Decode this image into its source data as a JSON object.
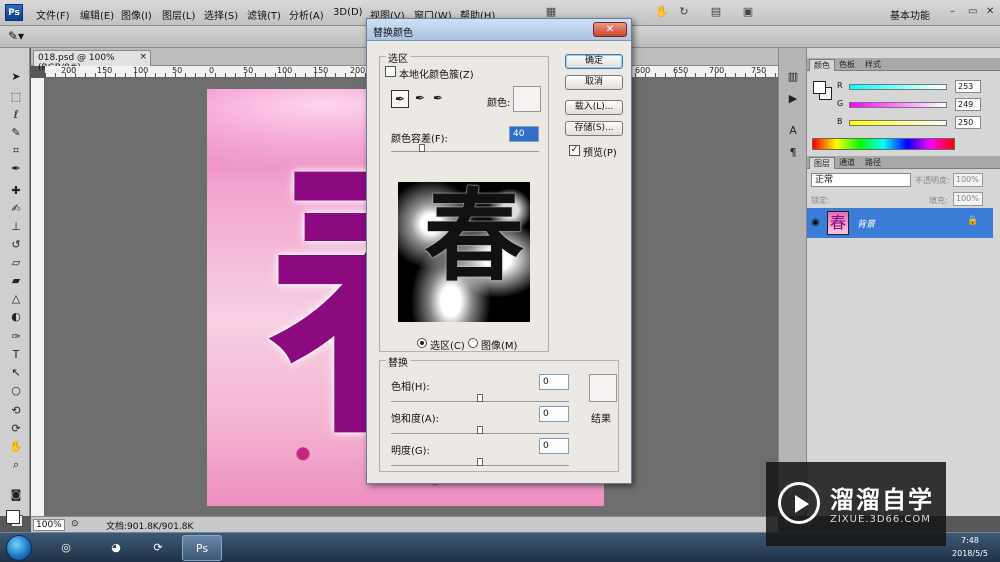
{
  "menubar": {
    "logo": "Ps",
    "items": [
      "文件(F)",
      "编辑(E)",
      "图像(I)",
      "图层(L)",
      "选择(S)",
      "滤镜(T)",
      "分析(A)",
      "3D(D)",
      "视图(V)",
      "窗口(W)",
      "帮助(H)"
    ],
    "workspace": "基本功能",
    "window_buttons": [
      "–",
      "▭",
      "✕"
    ]
  },
  "document": {
    "tab_title": "018.psd @ 100%(RGB/8#)",
    "tab_close": "×",
    "ruler_ticks": [
      "200",
      "150",
      "100",
      "50",
      "0",
      "50",
      "100",
      "150",
      "200",
      "250",
      "300",
      "350",
      "400",
      "450",
      "500",
      "550",
      "600",
      "650",
      "700",
      "750"
    ],
    "artwork_char": "春",
    "zoom": "100%",
    "status": "文档:901.8K/901.8K"
  },
  "dialog": {
    "title": "替换颜色",
    "close": "✕",
    "selection_group": "选区",
    "localized_clusters_label": "本地化颜色簇(Z)",
    "localized_clusters_checked": false,
    "color_label": "颜色:",
    "fuzziness_label": "颜色容差(F):",
    "fuzziness_value": "40",
    "fuzziness_fraction": 0.2,
    "preview_char": "春",
    "radio_selection": "选区(C)",
    "radio_image": "图像(M)",
    "replace_group": "替换",
    "hue_label": "色相(H):",
    "hue_value": "0",
    "saturation_label": "饱和度(A):",
    "saturation_value": "0",
    "lightness_label": "明度(G):",
    "lightness_value": "0",
    "result_label": "结果",
    "ok_label": "确定",
    "cancel_label": "取消",
    "load_label": "载入(L)...",
    "save_label": "存储(S)...",
    "preview_label": "预览(P)",
    "preview_checked": true,
    "sample_color": "#f6f2f2"
  },
  "color_panel": {
    "tabs": [
      "颜色",
      "色板",
      "样式"
    ],
    "r_value": "253",
    "g_value": "249",
    "b_value": "250"
  },
  "layers_panel": {
    "tabs": [
      "图层",
      "通道",
      "路径"
    ],
    "blend_mode": "正常",
    "opacity_label": "不透明度:",
    "opacity_value": "100%",
    "lock_label": "锁定:",
    "fill_label": "填充:",
    "fill_value": "100%",
    "layer_name": "背景",
    "selected_layer_color": "#3a7cd6"
  },
  "taskbar": {
    "time": "7:48",
    "date": "2018/5/5",
    "ps_label": "Ps"
  },
  "watermark": {
    "title": "溜溜自学",
    "subtitle": "ZIXUE.3D66.COM"
  }
}
